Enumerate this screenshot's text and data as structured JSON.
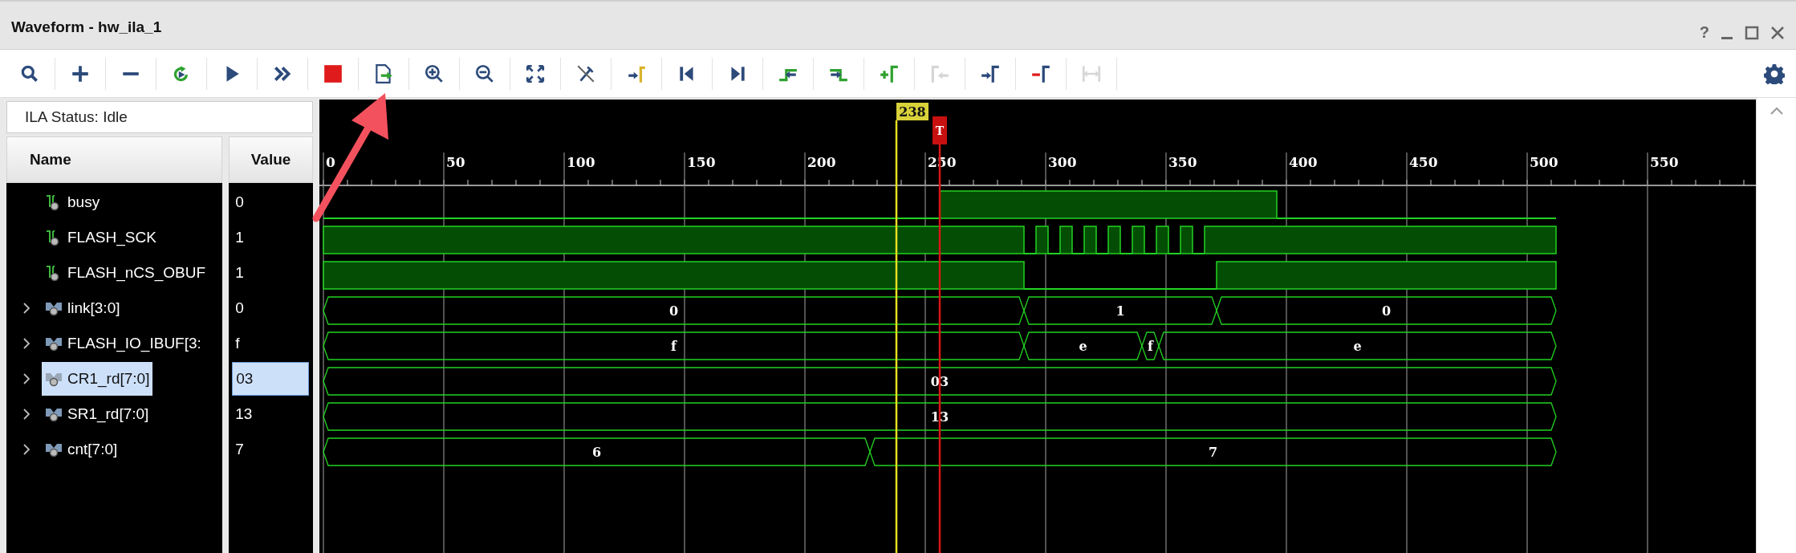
{
  "window": {
    "title": "Waveform - hw_ila_1",
    "help": "?"
  },
  "toolbar": [
    {
      "kind": "search",
      "disabled": false
    },
    {
      "kind": "add",
      "disabled": false
    },
    {
      "kind": "remove",
      "disabled": false
    },
    {
      "kind": "refresh",
      "disabled": false
    },
    {
      "kind": "run",
      "disabled": false
    },
    {
      "kind": "run-immediate",
      "disabled": false
    },
    {
      "kind": "stop",
      "disabled": false
    },
    {
      "kind": "export",
      "disabled": false
    },
    {
      "kind": "zoom-in",
      "disabled": false
    },
    {
      "kind": "zoom-out",
      "disabled": false
    },
    {
      "kind": "zoom-fit",
      "disabled": false
    },
    {
      "kind": "cursor-off",
      "disabled": false
    },
    {
      "kind": "go-to-cursor",
      "disabled": false
    },
    {
      "kind": "go-to-start",
      "disabled": false
    },
    {
      "kind": "go-to-end",
      "disabled": false
    },
    {
      "kind": "prev-transition",
      "disabled": false
    },
    {
      "kind": "next-transition",
      "disabled": false
    },
    {
      "kind": "add-marker",
      "disabled": false
    },
    {
      "kind": "prev-marker",
      "disabled": true
    },
    {
      "kind": "next-marker",
      "disabled": false
    },
    {
      "kind": "delete-marker",
      "disabled": false
    },
    {
      "kind": "swap-cursors",
      "disabled": true
    }
  ],
  "ila_status": "ILA Status: Idle",
  "columns": [
    "Name",
    "Value"
  ],
  "timeline": {
    "ticks": [
      "0",
      "50",
      "100",
      "150",
      "200",
      "250",
      "300",
      "350",
      "400",
      "450",
      "500",
      "550"
    ],
    "cursor": "238",
    "trigger": "T"
  },
  "signals": [
    {
      "name": "busy",
      "value": "0",
      "kind": "bit",
      "expandable": false,
      "selected": false,
      "wave": [
        {
          "high": false
        },
        {
          "high": true
        },
        {
          "high": false
        }
      ]
    },
    {
      "name": "FLASH_SCK",
      "value": "1",
      "kind": "bit",
      "expandable": false,
      "selected": false,
      "wave": [
        {
          "high": true
        },
        {
          "high": false
        },
        {
          "high": true
        },
        {
          "high": false
        },
        {
          "high": true
        },
        {
          "high": false
        },
        {
          "high": true
        },
        {
          "high": false
        },
        {
          "high": true
        },
        {
          "high": false
        },
        {
          "high": true
        },
        {
          "high": false
        },
        {
          "high": true
        },
        {
          "high": false
        },
        {
          "high": true
        },
        {
          "high": false
        },
        {
          "high": true
        }
      ]
    },
    {
      "name": "FLASH_nCS_OBUF",
      "value": "1",
      "kind": "bit",
      "expandable": false,
      "selected": false,
      "wave": [
        {
          "high": true
        },
        {
          "high": false
        },
        {
          "high": true
        }
      ]
    },
    {
      "name": "link[3:0]",
      "value": "0",
      "kind": "bus",
      "expandable": true,
      "selected": false,
      "wave": [
        {
          "label": "0"
        },
        {
          "label": "1"
        },
        {
          "label": "0"
        }
      ]
    },
    {
      "name": "FLASH_IO_IBUF[3:",
      "value": "f",
      "kind": "bus",
      "expandable": true,
      "selected": false,
      "wave": [
        {
          "label": "f"
        },
        {
          "label": "e"
        },
        {
          "label": "f"
        },
        {
          "label": "e"
        }
      ]
    },
    {
      "name": "CR1_rd[7:0]",
      "value": "03",
      "kind": "bus",
      "expandable": true,
      "selected": true,
      "wave": [
        {
          "label": "03"
        }
      ]
    },
    {
      "name": "SR1_rd[7:0]",
      "value": "13",
      "kind": "bus",
      "expandable": true,
      "selected": false,
      "wave": [
        {
          "label": "13"
        }
      ]
    },
    {
      "name": "cnt[7:0]",
      "value": "7",
      "kind": "bus",
      "expandable": true,
      "selected": false,
      "wave": [
        {
          "label": "6"
        },
        {
          "label": "7"
        }
      ]
    }
  ]
}
